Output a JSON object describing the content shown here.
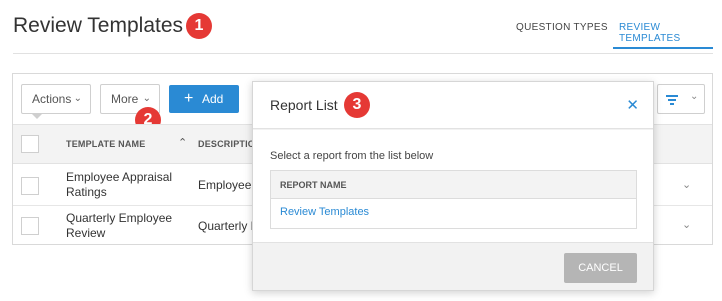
{
  "header": {
    "title": "Review Templates",
    "tabs": [
      {
        "label": "QUESTION TYPES",
        "active": false
      },
      {
        "label": "REVIEW TEMPLATES",
        "active": true
      }
    ]
  },
  "callouts": [
    "1",
    "2",
    "3"
  ],
  "toolbar": {
    "actions_label": "Actions",
    "more_label": "More",
    "add_label": "Add",
    "icons": [
      "chevron-down-icon",
      "plus-icon",
      "filter-icon"
    ]
  },
  "table": {
    "columns": [
      "TEMPLATE NAME",
      "DESCRIPTION"
    ],
    "rows": [
      {
        "name_line1": "Employee Appraisal",
        "name_line2": "Ratings",
        "description": "Employee"
      },
      {
        "name_line1": "Quarterly Employee",
        "name_line2": "Review",
        "description": "Quarterly E"
      }
    ]
  },
  "modal": {
    "title": "Report List",
    "instruction": "Select a report from the list below",
    "column_header": "REPORT NAME",
    "reports": [
      "Review Templates"
    ],
    "cancel_label": "CANCEL"
  },
  "colors": {
    "accent": "#2a8ad4",
    "callout": "#e53935",
    "disabled_button": "#b5b5b5"
  }
}
